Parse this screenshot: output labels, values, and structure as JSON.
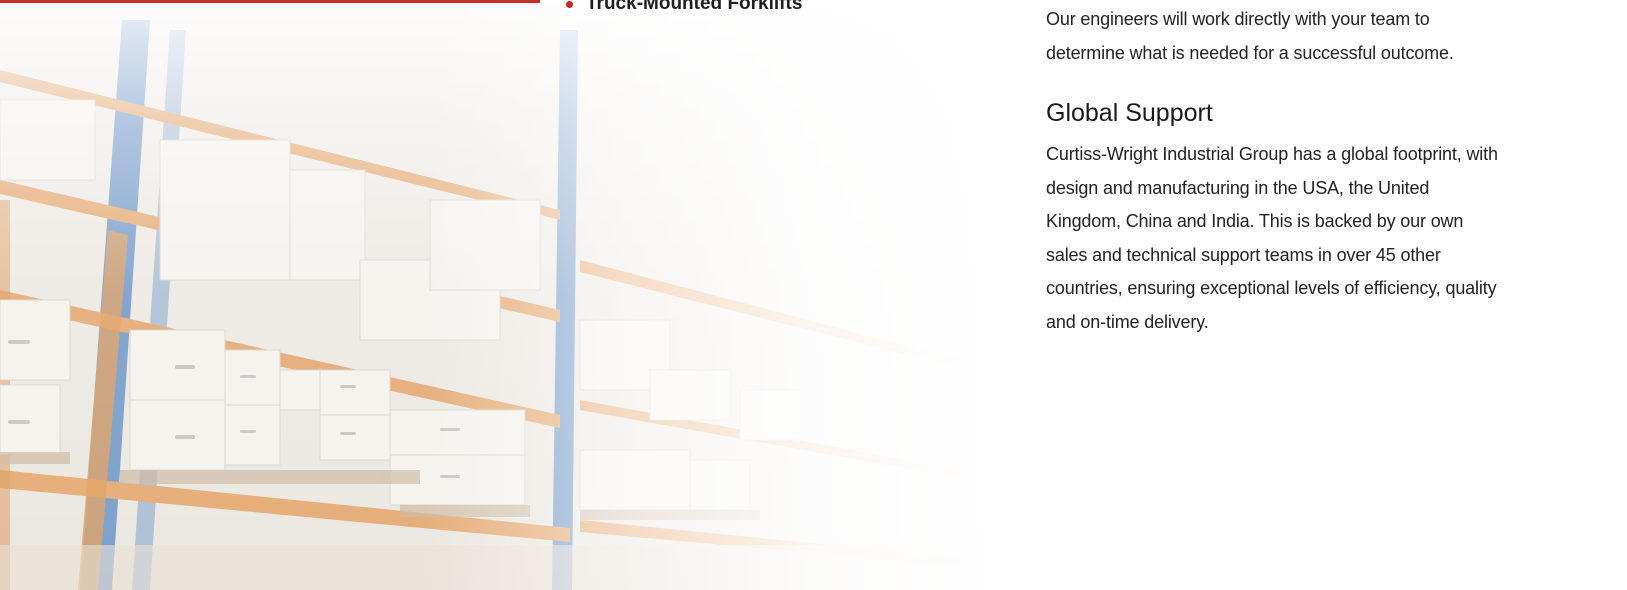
{
  "list": {
    "items": [
      {
        "label": "Truck-Mounted Forklifts"
      }
    ]
  },
  "engineering": {
    "text": "Our engineers will work directly with your team to determine what is needed for a successful outcome."
  },
  "global_support": {
    "heading": "Global Support",
    "text": "Curtiss-Wright Industrial Group has a global footprint, with design and manufacturing in the USA, the United Kingdom, China and India. This is backed by our own sales and technical support teams in over 45 other countries, ensuring exceptional levels of efficiency, quality and on-time delivery."
  },
  "colors": {
    "accent": "#d0202a",
    "text": "#222222"
  },
  "background": {
    "icon": "warehouse-shelves-image"
  }
}
